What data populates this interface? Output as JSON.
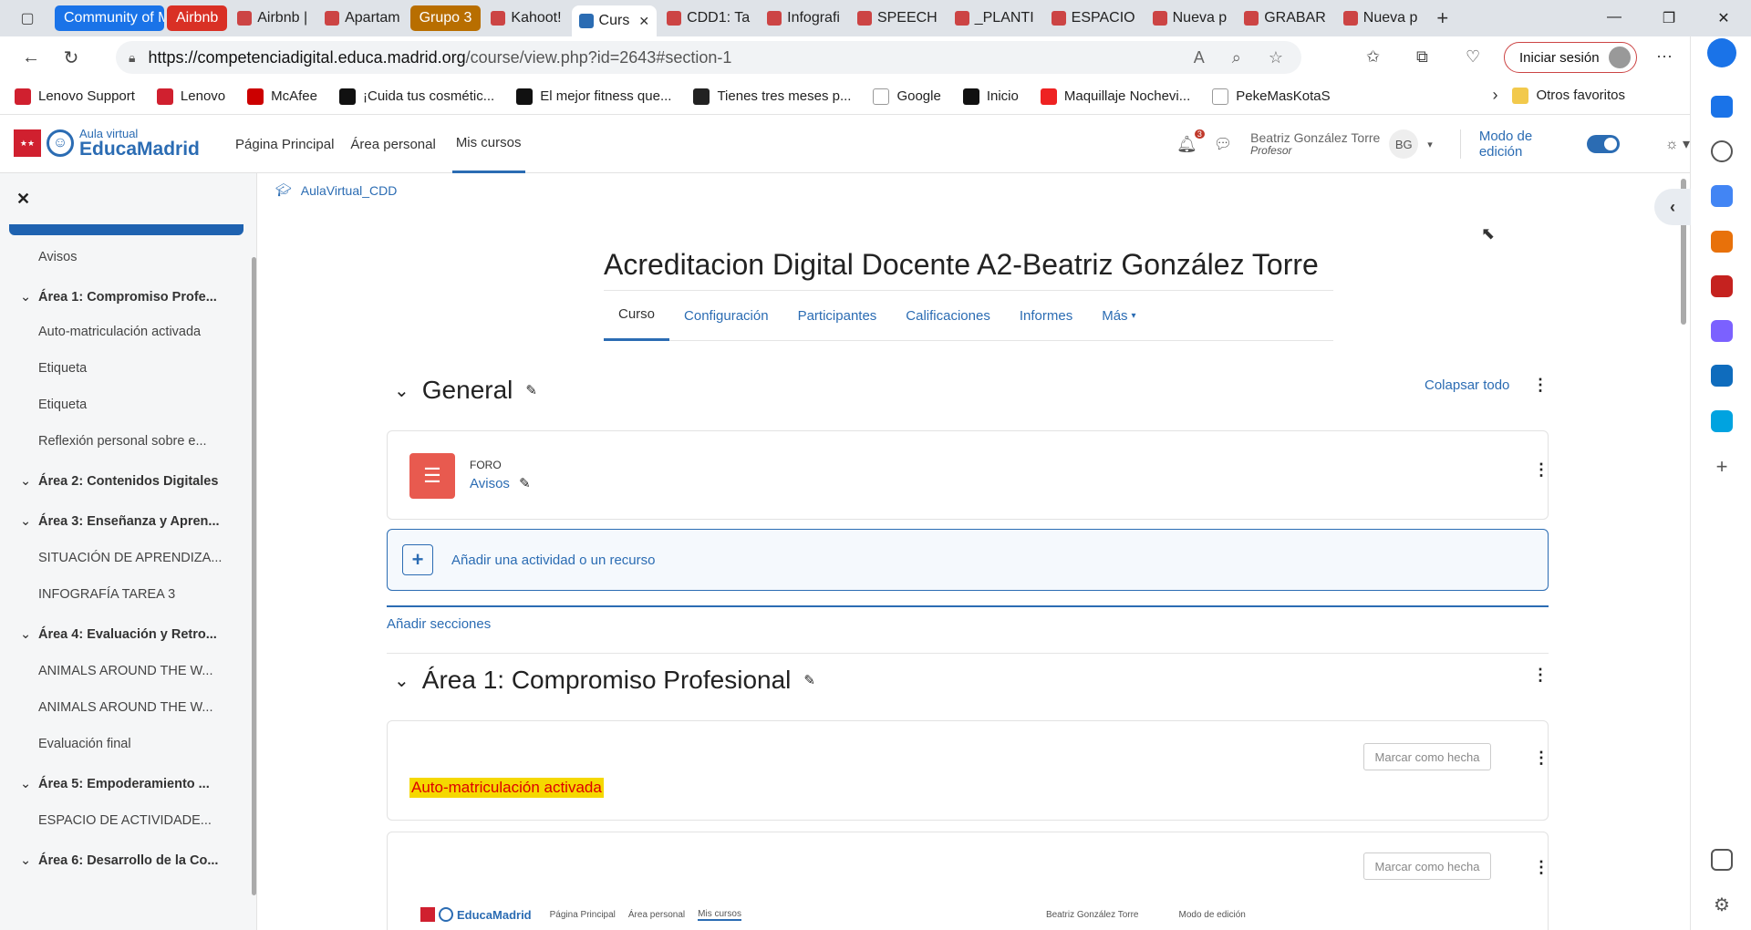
{
  "browser": {
    "tabs": [
      {
        "label": "Community of Madrid",
        "color": "#1a73e8",
        "group": true
      },
      {
        "label": "Airbnb",
        "color": "#d93025",
        "group": true
      },
      {
        "label": "Airbnb |",
        "group": false
      },
      {
        "label": "Apartam",
        "group": false
      },
      {
        "label": "Grupo 3",
        "color": "#b86e00",
        "group": true
      },
      {
        "label": "Kahoot!",
        "group": false
      },
      {
        "label": "Curs",
        "group": false,
        "active": true
      },
      {
        "label": "CDD1: Ta",
        "group": false
      },
      {
        "label": "Infografi",
        "group": false
      },
      {
        "label": "SPEECH",
        "group": false
      },
      {
        "label": "_PLANTI",
        "group": false
      },
      {
        "label": "ESPACIO",
        "group": false
      },
      {
        "label": "Nueva p",
        "group": false
      },
      {
        "label": "GRABAR",
        "group": false
      },
      {
        "label": "Nueva p",
        "group": false
      }
    ],
    "url_host": "https://competenciadigital.educa.madrid.org",
    "url_path": "/course/view.php?id=2643#section-1",
    "signin_label": "Iniciar sesión",
    "bookmarks": [
      "Lenovo Support",
      "Lenovo",
      "McAfee",
      "¡Cuida tus cosmétic...",
      "El mejor fitness que...",
      "Tienes tres meses p...",
      "Google",
      "Inicio",
      "Maquillaje Nochevi...",
      "PekeMasKotaS"
    ],
    "other_favorites": "Otros favoritos"
  },
  "header": {
    "logo_line1": "Aula virtual",
    "logo_line2": "EducaMadrid",
    "nav": [
      "Página Principal",
      "Área personal",
      "Mis cursos"
    ],
    "notif_count": "3",
    "user_name": "Beatriz González Torre",
    "user_role": "Profesor",
    "user_initials": "BG",
    "edit_mode_label": "Modo de edición"
  },
  "drawer": {
    "items": [
      {
        "type": "item",
        "label": "Avisos"
      },
      {
        "type": "section",
        "label": "Área 1: Compromiso Profe..."
      },
      {
        "type": "item",
        "label": "Auto-matriculación activada"
      },
      {
        "type": "item",
        "label": "Etiqueta"
      },
      {
        "type": "item",
        "label": "Etiqueta"
      },
      {
        "type": "item",
        "label": "Reflexión personal sobre e..."
      },
      {
        "type": "section",
        "label": "Área 2: Contenidos Digitales"
      },
      {
        "type": "section",
        "label": "Área 3: Enseñanza y Apren..."
      },
      {
        "type": "item",
        "label": "SITUACIÓN DE APRENDIZA..."
      },
      {
        "type": "item",
        "label": "INFOGRAFÍA TAREA 3"
      },
      {
        "type": "section",
        "label": "Área 4: Evaluación y Retro..."
      },
      {
        "type": "item",
        "label": "ANIMALS AROUND THE W..."
      },
      {
        "type": "item",
        "label": "ANIMALS AROUND THE W..."
      },
      {
        "type": "item",
        "label": "Evaluación final"
      },
      {
        "type": "section",
        "label": "Área 5: Empoderamiento ..."
      },
      {
        "type": "item",
        "label": "ESPACIO DE ACTIVIDADE..."
      },
      {
        "type": "section",
        "label": "Área 6: Desarrollo de la Co..."
      }
    ]
  },
  "main": {
    "breadcrumb": "AulaVirtual_CDD",
    "title": "Acreditacion Digital Docente A2-Beatriz González Torre",
    "tabs": [
      "Curso",
      "Configuración",
      "Participantes",
      "Calificaciones",
      "Informes",
      "Más"
    ],
    "general_title": "General",
    "collapse_all": "Colapsar todo",
    "forum_type": "FORO",
    "forum_name": "Avisos",
    "add_activity": "Añadir una actividad o un recurso",
    "add_sections": "Añadir secciones",
    "section1_title": "Área 1: Compromiso Profesional",
    "mark_done": "Marcar como hecha",
    "highlight_text": "Auto-matriculación activada",
    "mini_logo": "EducaMadrid",
    "mini_nav": [
      "Página Principal",
      "Área personal",
      "Mis cursos"
    ],
    "mini_user": "Beatriz González Torre",
    "mini_edit": "Modo de edición"
  }
}
